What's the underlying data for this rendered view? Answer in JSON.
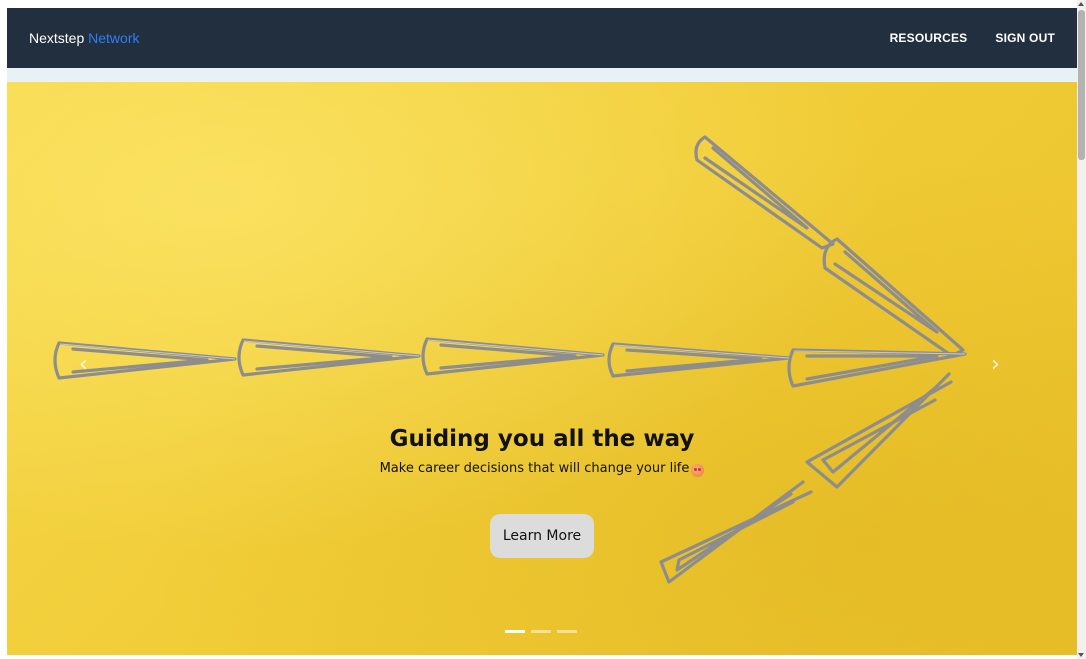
{
  "navbar": {
    "brand_first": "Nextstep",
    "brand_second": "Network",
    "links": [
      "RESOURCES",
      "SIGN OUT"
    ]
  },
  "hero": {
    "title": "Guiding you all the way",
    "subtitle": "Make career decisions that will change your life",
    "subtitle_emoji": "smiling-face-emoji",
    "button_label": "Learn More",
    "prev_arrow": "‹",
    "next_arrow": "›",
    "slide_count": 3,
    "active_slide": 1
  },
  "colors": {
    "navbar_bg": "#222f3e",
    "brand_accent": "#2f7df6",
    "hero_bg": "#f2cf3a",
    "button_bg": "#dcdcdc"
  },
  "icons": {
    "prev": "chevron-left-icon",
    "next": "chevron-right-icon"
  }
}
